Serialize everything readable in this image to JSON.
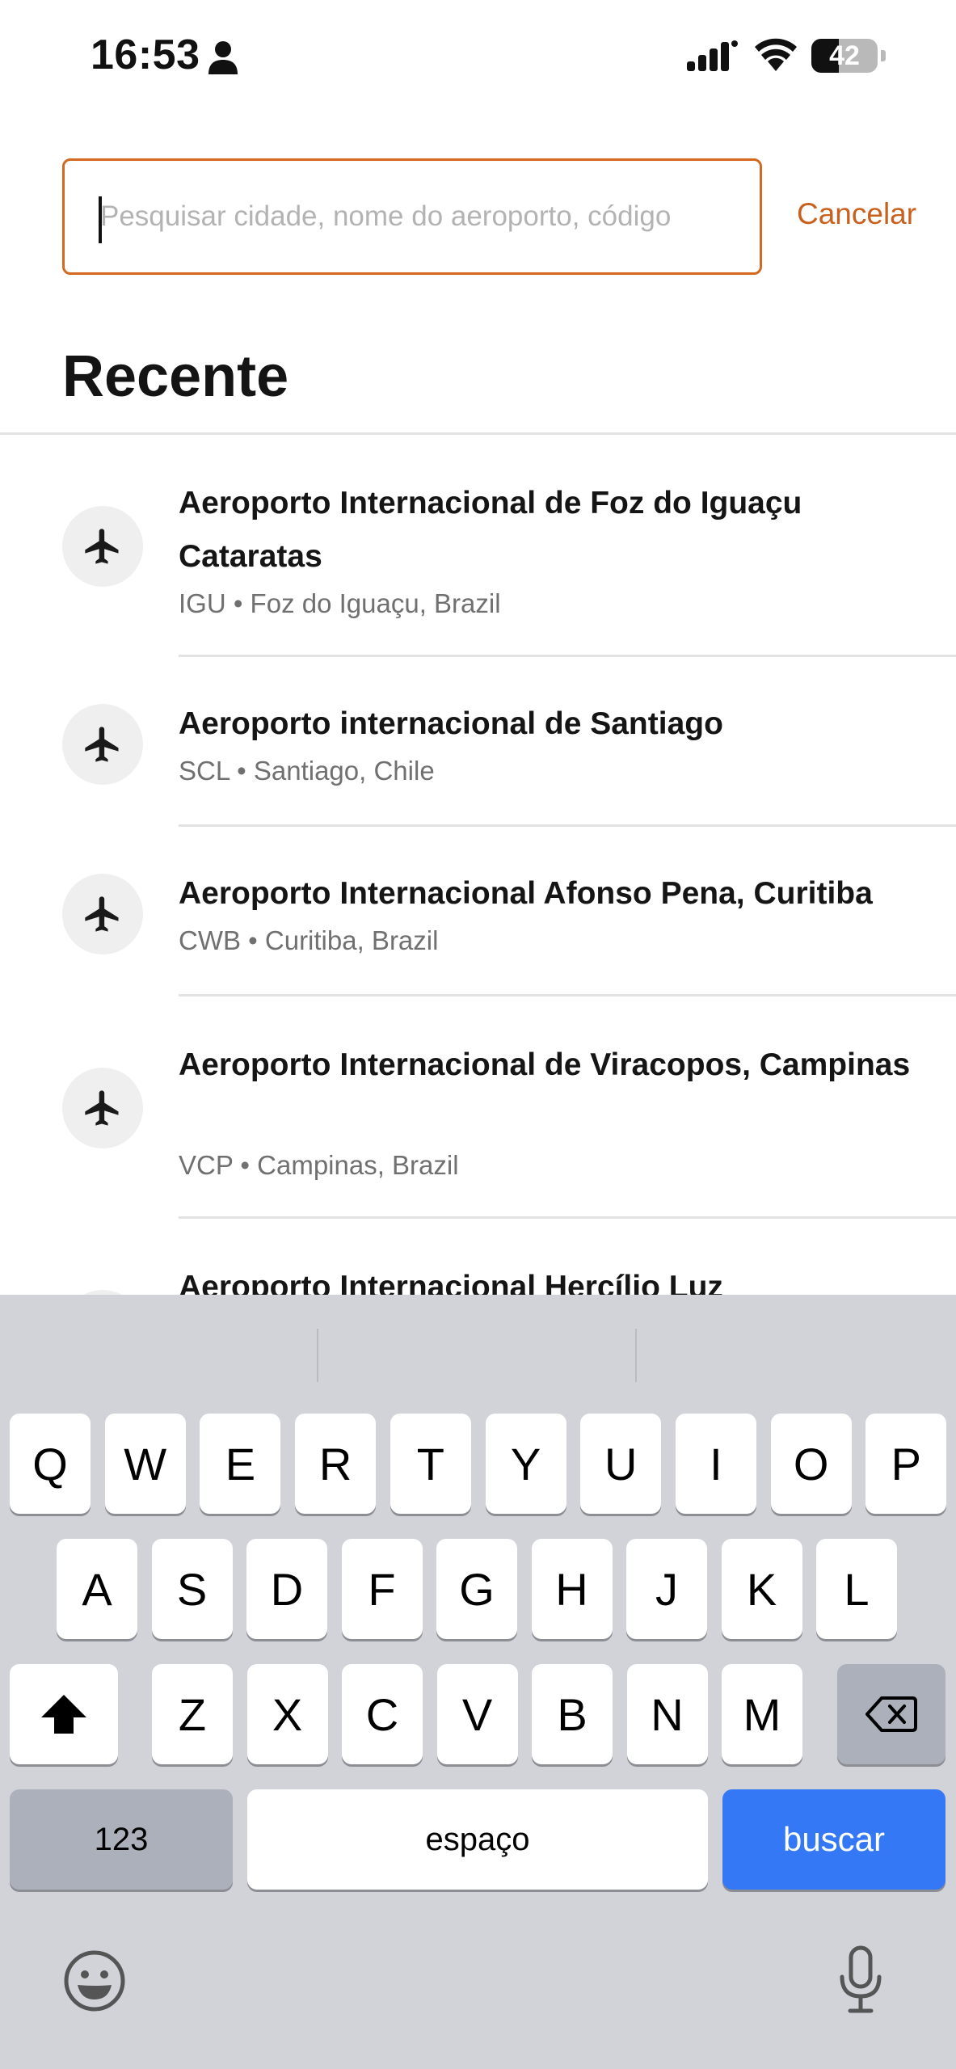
{
  "status_bar": {
    "time": "16:53",
    "battery": "42",
    "battery_level": 0.42
  },
  "search": {
    "placeholder": "Pesquisar cidade, nome do aeroporto, código",
    "value": "",
    "cancel_label": "Cancelar",
    "accent_color": "#d2691e"
  },
  "recent": {
    "title": "Recente",
    "items": [
      {
        "name": "Aeroporto Internacional de Foz do Iguaçu Cataratas",
        "detail": "IGU • Foz do Iguaçu, Brazil"
      },
      {
        "name": "Aeroporto internacional de Santiago",
        "detail": "SCL • Santiago, Chile"
      },
      {
        "name": "Aeroporto Internacional Afonso Pena, Curitiba",
        "detail": "CWB • Curitiba, Brazil"
      },
      {
        "name": "Aeroporto Internacional de Viracopos, Campinas",
        "detail": "VCP • Campinas, Brazil"
      },
      {
        "name": "Aeroporto Internacional Hercílio Luz",
        "detail": ""
      }
    ]
  },
  "keyboard": {
    "row1": [
      "Q",
      "W",
      "E",
      "R",
      "T",
      "Y",
      "U",
      "I",
      "O",
      "P"
    ],
    "row2": [
      "A",
      "S",
      "D",
      "F",
      "G",
      "H",
      "J",
      "K",
      "L"
    ],
    "row3": [
      "Z",
      "X",
      "C",
      "V",
      "B",
      "N",
      "M"
    ],
    "numbers_label": "123",
    "space_label": "espaço",
    "return_label": "buscar",
    "return_color": "#3478f6"
  }
}
